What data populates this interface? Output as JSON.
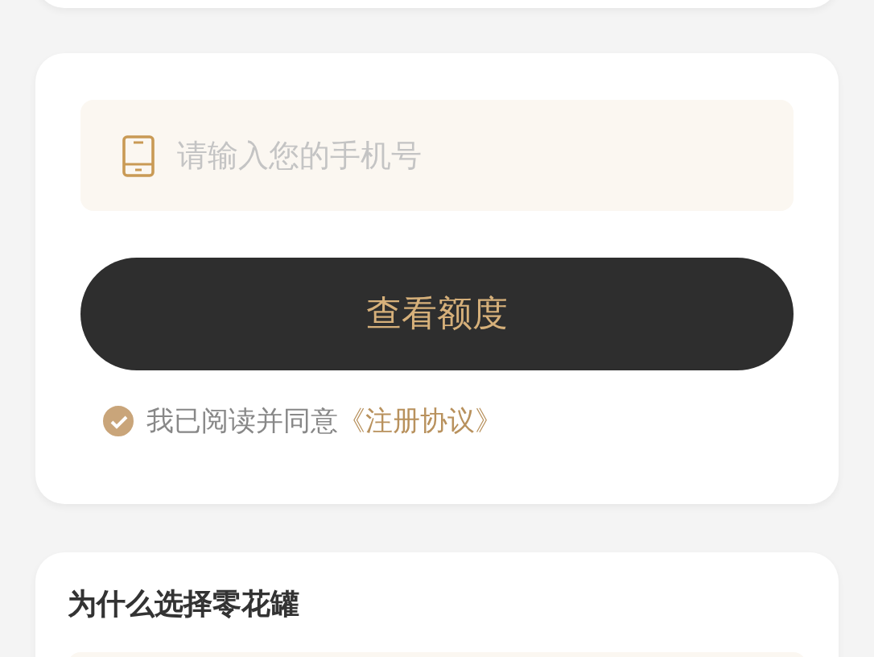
{
  "login_card": {
    "phone_field": {
      "placeholder": "请输入您的手机号"
    },
    "submit_button": "查看额度",
    "agreement": {
      "checked": true,
      "text": "我已阅读并同意",
      "link": "《注册协议》"
    }
  },
  "why_card": {
    "title": "为什么选择零花罐"
  }
}
